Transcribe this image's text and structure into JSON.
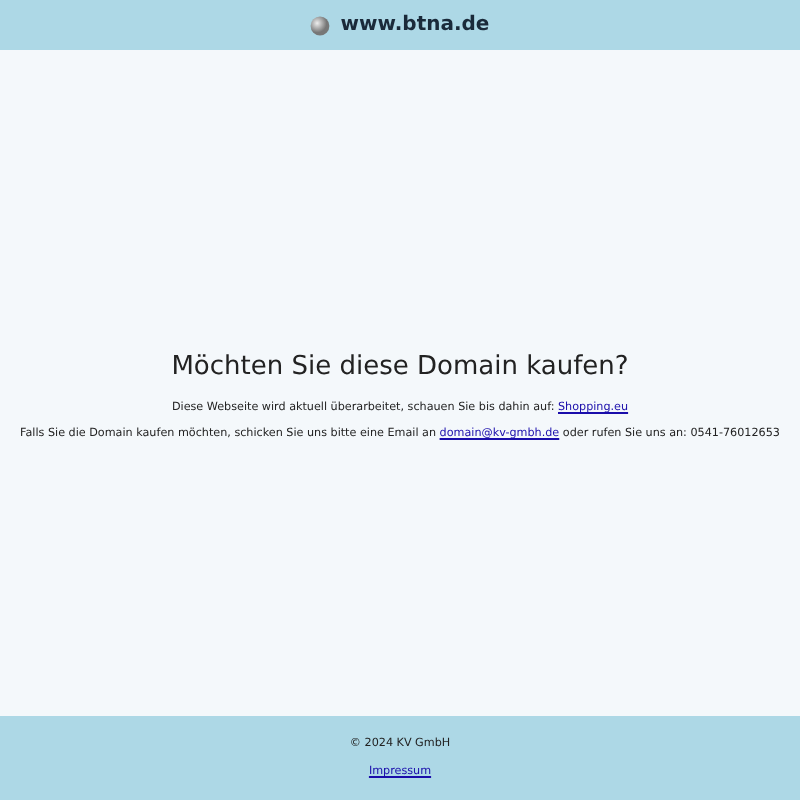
{
  "header": {
    "site": "www.btna.de"
  },
  "main": {
    "heading": "Möchten Sie diese Domain kaufen?",
    "paragraphs": [
      {
        "before": "Diese Webseite wird aktuell überarbeitet, schauen Sie bis dahin auf: ",
        "link": "Shopping.eu"
      },
      {
        "before": "Falls Sie die Domain kaufen möchten, schicken Sie uns bitte eine Email an ",
        "link": "domain@kv-gmbh.de",
        "after": " oder rufen Sie uns an: 0541-76012653"
      }
    ]
  },
  "footer": {
    "copyright": "© 2024 KV GmbH",
    "link": "Impressum"
  }
}
